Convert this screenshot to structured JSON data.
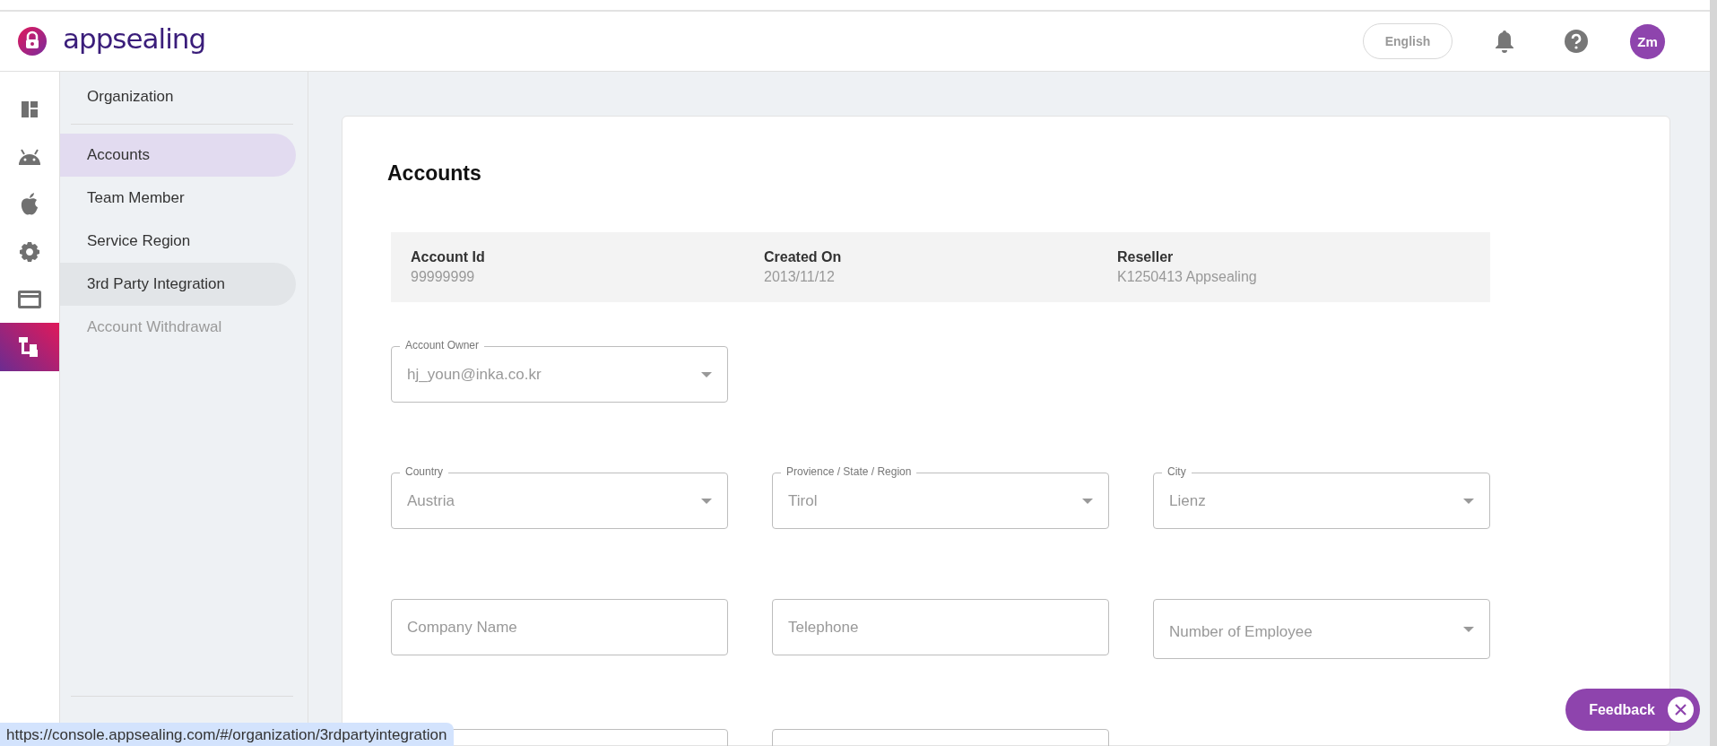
{
  "header": {
    "logo_text": "appsealing",
    "language": "English",
    "avatar": "Zm"
  },
  "rail": [
    {
      "selected": false
    },
    {
      "selected": false
    },
    {
      "selected": false
    },
    {
      "selected": false
    },
    {
      "selected": false
    },
    {
      "selected": true
    }
  ],
  "submenu": {
    "title": "Organization",
    "items": [
      {
        "label": "Accounts",
        "selected": true,
        "hovered": false,
        "disabled": false
      },
      {
        "label": "Team Member",
        "selected": false,
        "hovered": false,
        "disabled": false
      },
      {
        "label": "Service Region",
        "selected": false,
        "hovered": false,
        "disabled": false
      },
      {
        "label": "3rd Party Integration",
        "selected": false,
        "hovered": true,
        "disabled": false
      },
      {
        "label": "Account Withdrawal",
        "selected": false,
        "hovered": false,
        "disabled": true
      }
    ]
  },
  "page": {
    "title": "Accounts",
    "info": [
      {
        "label": "Account Id",
        "value": "99999999"
      },
      {
        "label": "Created On",
        "value": "2013/11/12"
      },
      {
        "label": "Reseller",
        "value": "K1250413 Appsealing"
      }
    ],
    "field_rows": [
      [
        {
          "kind": "select",
          "label": "Account Owner",
          "value": "hj_youn@inka.co.kr"
        }
      ],
      [
        {
          "kind": "select",
          "label": "Country",
          "value": "Austria"
        },
        {
          "kind": "select",
          "label": "Provience / State / Region",
          "value": "Tirol"
        },
        {
          "kind": "select",
          "label": "City",
          "value": "Lienz"
        }
      ],
      [
        {
          "kind": "text",
          "placeholder": "Company Name"
        },
        {
          "kind": "text",
          "placeholder": "Telephone"
        },
        {
          "kind": "select",
          "placeholder": "Number of Employee"
        }
      ],
      [
        {
          "kind": "text"
        },
        {
          "kind": "text"
        }
      ]
    ]
  },
  "status_url": "https://console.appsealing.com/#/organization/3rdpartyintegration",
  "feedback": {
    "label": "Feedback"
  }
}
